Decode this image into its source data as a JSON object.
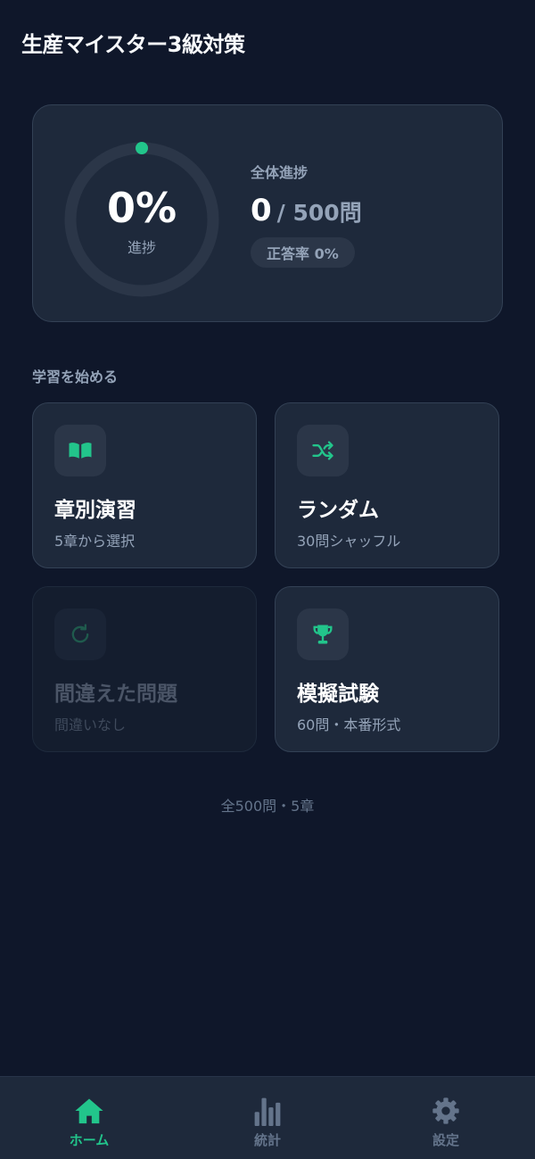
{
  "app": {
    "title": "生産マイスター3級対策"
  },
  "progress": {
    "percent_text": "0%",
    "percent_value": 0,
    "caption": "進捗",
    "overall_label": "全体進捗",
    "answered": "0",
    "total": "/ 500問",
    "accuracy": "正答率 0%"
  },
  "section": {
    "heading": "学習を始める"
  },
  "modes": [
    {
      "title": "章別演習",
      "subtitle": "5章から選択",
      "icon": "book-open-icon",
      "enabled": true
    },
    {
      "title": "ランダム",
      "subtitle": "30問シャッフル",
      "icon": "shuffle-icon",
      "enabled": true
    },
    {
      "title": "間違えた問題",
      "subtitle": "間違いなし",
      "icon": "refresh-icon",
      "enabled": false
    },
    {
      "title": "模擬試験",
      "subtitle": "60問・本番形式",
      "icon": "trophy-icon",
      "enabled": true
    }
  ],
  "footer": {
    "note": "全500問・5章"
  },
  "nav": [
    {
      "label": "ホーム",
      "icon": "home-icon",
      "active": true
    },
    {
      "label": "統計",
      "icon": "bar-chart-icon",
      "active": false
    },
    {
      "label": "設定",
      "icon": "gear-icon",
      "active": false
    }
  ],
  "colors": {
    "background": "#0f172a",
    "card": "#1e293b",
    "accent": "#22c58b",
    "muted_text": "#94a3b8"
  }
}
